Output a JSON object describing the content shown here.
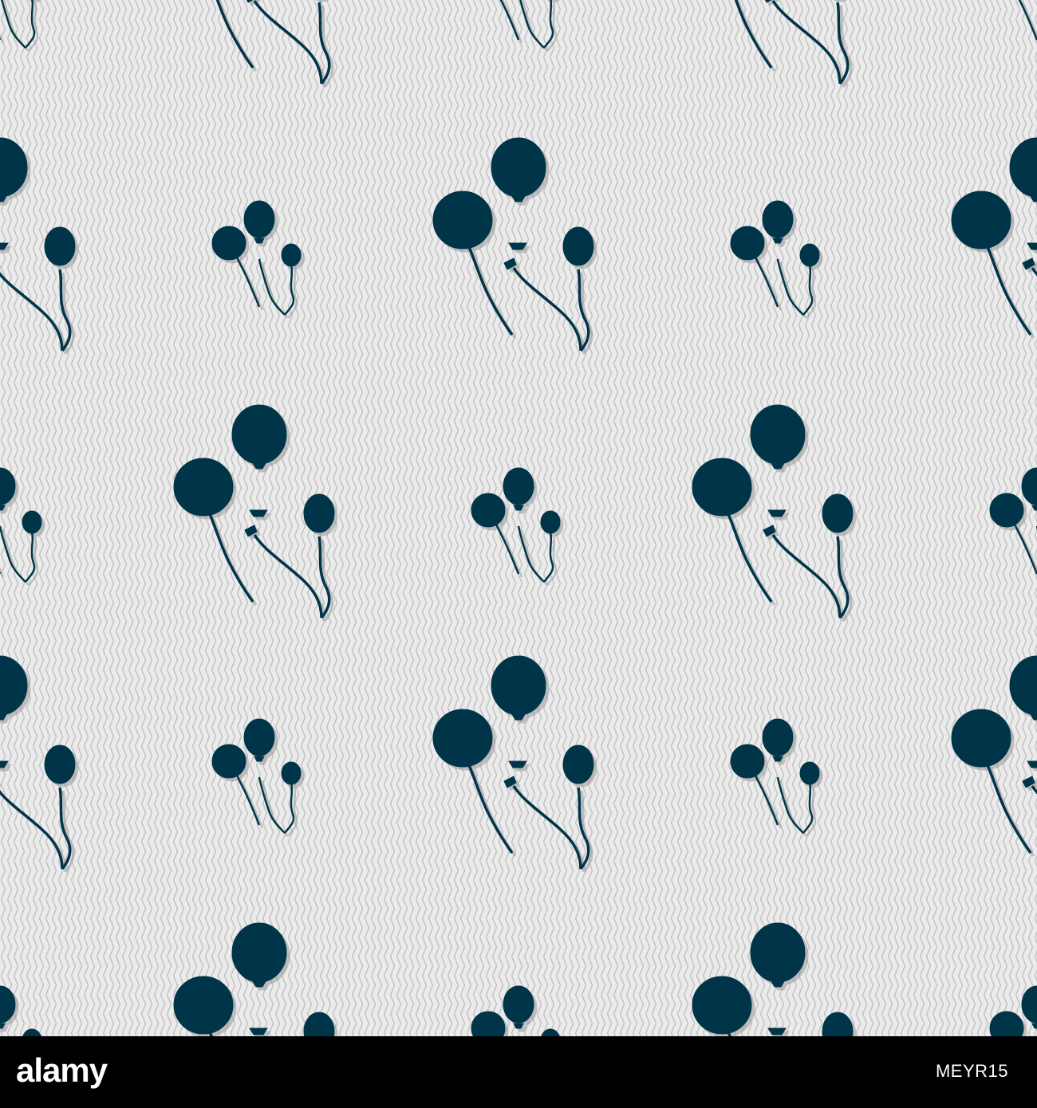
{
  "pattern": {
    "background_color": "#ebebeb",
    "line_color": "#c4c4c4",
    "icon_color": "#003549",
    "shadow_color": "#9a9a9a",
    "icon_name": "balloons-icon"
  },
  "footer": {
    "background_color": "#000000",
    "text_color": "#ffffff",
    "brand": "alamy",
    "image_id": "MEYR15"
  }
}
